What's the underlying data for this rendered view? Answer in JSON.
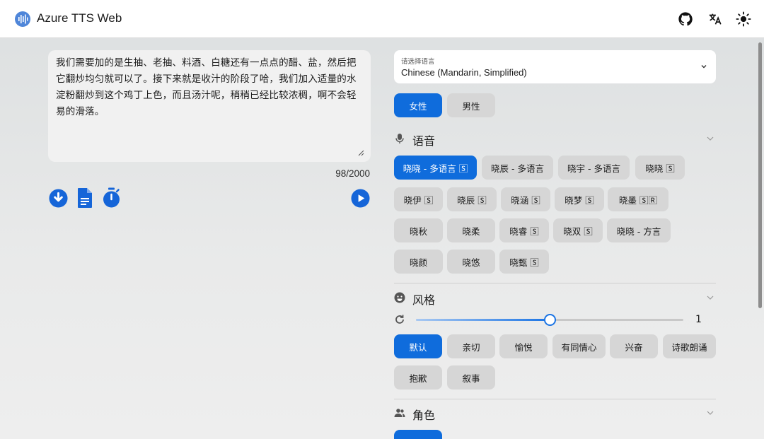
{
  "header": {
    "title": "Azure TTS Web",
    "icons": [
      "github-icon",
      "translate-icon",
      "theme-sun-icon"
    ]
  },
  "editor": {
    "text": "我们需要加的是生抽、老抽、料酒、白糖还有一点点的醋、盐，然后把它翻炒均匀就可以了。接下来就是收汁的阶段了哈，我们加入适量的水淀粉翻炒到这个鸡丁上色，而且汤汁呢，稍稍已经比较浓稠，啊不会轻易的滑落。",
    "char_count": "98/2000",
    "actions": [
      "download-icon",
      "document-icon",
      "timer-icon",
      "play-icon"
    ]
  },
  "language": {
    "label": "请选择语言",
    "value": "Chinese (Mandarin, Simplified)"
  },
  "gender": {
    "options": [
      {
        "label": "女性",
        "selected": true
      },
      {
        "label": "男性",
        "selected": false
      }
    ]
  },
  "voice": {
    "title": "语音",
    "items": [
      {
        "label": "晓晓 - 多语言 🅂",
        "selected": true
      },
      {
        "label": "晓辰 - 多语言",
        "selected": false
      },
      {
        "label": "晓宇 - 多语言",
        "selected": false
      },
      {
        "label": "晓晓 🅂",
        "selected": false
      },
      {
        "label": "晓伊 🅂",
        "selected": false
      },
      {
        "label": "晓辰 🅂",
        "selected": false
      },
      {
        "label": "晓涵 🅂",
        "selected": false
      },
      {
        "label": "晓梦 🅂",
        "selected": false
      },
      {
        "label": "晓墨 🅂🅁",
        "selected": false
      },
      {
        "label": "晓秋",
        "selected": false
      },
      {
        "label": "晓柔",
        "selected": false
      },
      {
        "label": "晓睿 🅂",
        "selected": false
      },
      {
        "label": "晓双 🅂",
        "selected": false
      },
      {
        "label": "晓晓 - 方言",
        "selected": false
      },
      {
        "label": "晓颜",
        "selected": false
      },
      {
        "label": "晓悠",
        "selected": false
      },
      {
        "label": "晓甄 🅂",
        "selected": false
      }
    ]
  },
  "style": {
    "title": "风格",
    "intensity": 1,
    "intensity_fraction": 0.5,
    "items": [
      {
        "label": "默认",
        "selected": true
      },
      {
        "label": "亲切",
        "selected": false
      },
      {
        "label": "愉悦",
        "selected": false
      },
      {
        "label": "有同情心",
        "selected": false
      },
      {
        "label": "兴奋",
        "selected": false
      },
      {
        "label": "诗歌朗诵",
        "selected": false
      },
      {
        "label": "抱歉",
        "selected": false
      },
      {
        "label": "叙事",
        "selected": false
      }
    ]
  },
  "role": {
    "title": "角色"
  },
  "colors": {
    "accent": "#0f6cdc",
    "chip": "#d6d6d6"
  }
}
